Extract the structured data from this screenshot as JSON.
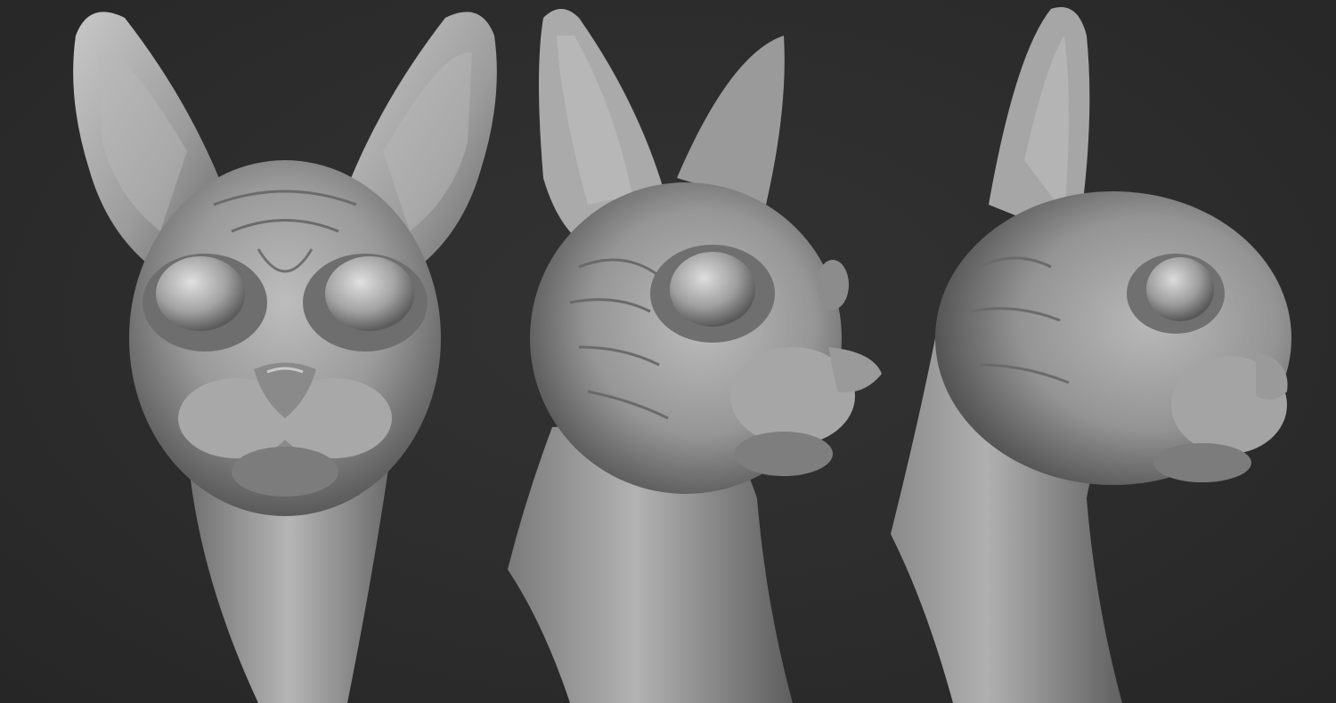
{
  "scene": {
    "background_color": "#2e2e2e",
    "material_base": "#9a9a9a",
    "material_highlight": "#d6d6d6",
    "material_shadow": "#4a4a4a",
    "views": [
      {
        "id": "front",
        "subject": "sphynx-cat-bust",
        "angle": "front"
      },
      {
        "id": "three-quarter",
        "subject": "sphynx-cat-bust",
        "angle": "three-quarter"
      },
      {
        "id": "side",
        "subject": "sphynx-cat-bust",
        "angle": "side"
      }
    ]
  }
}
